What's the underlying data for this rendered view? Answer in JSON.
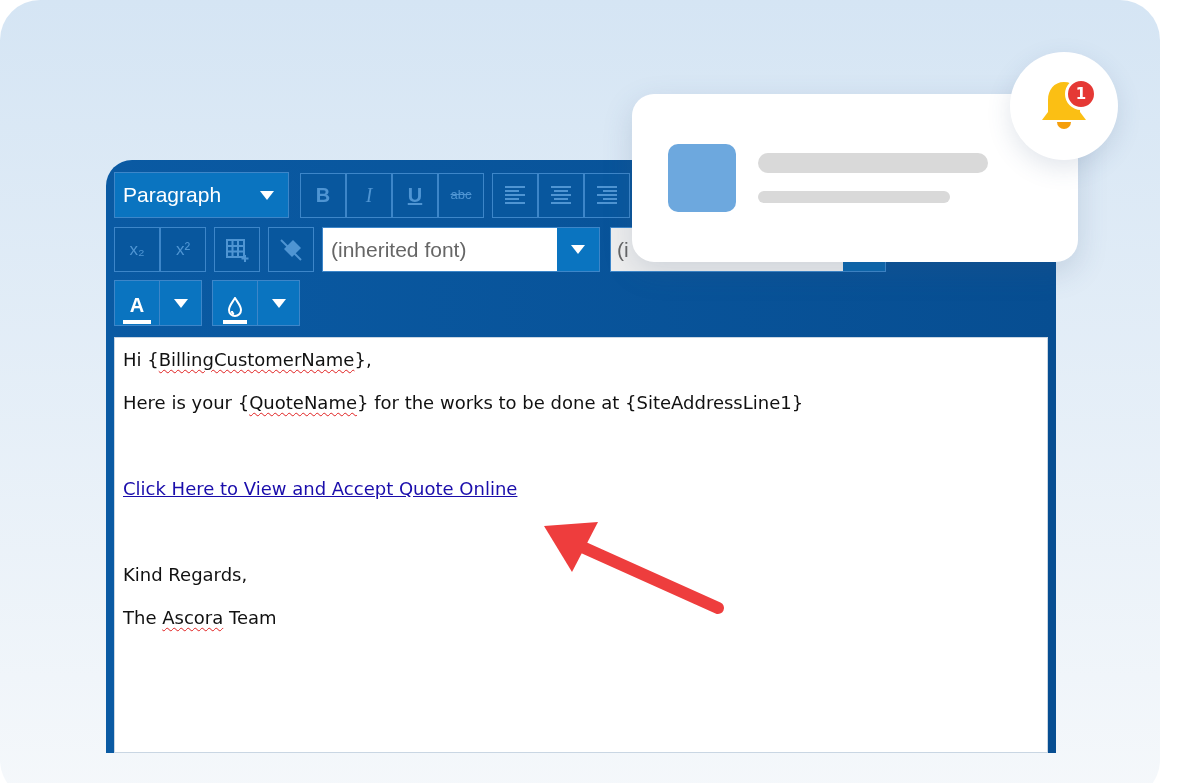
{
  "toolbar": {
    "block_format": "Paragraph",
    "row_1": [
      {
        "label": "B",
        "kind": "bold",
        "disabled": true
      },
      {
        "label": "I",
        "kind": "italic",
        "disabled": true
      },
      {
        "label": "U",
        "kind": "underline",
        "disabled": true
      },
      {
        "label": "abc",
        "kind": "strike",
        "disabled": true
      },
      {
        "kind": "align-left",
        "disabled": true
      },
      {
        "kind": "align-center",
        "disabled": true
      },
      {
        "kind": "align-right",
        "disabled": true
      }
    ],
    "row_2": [
      {
        "label": "x₂",
        "kind": "text",
        "disabled": true
      },
      {
        "label": "x²",
        "kind": "text",
        "disabled": true
      },
      {
        "kind": "table",
        "disabled": true
      },
      {
        "kind": "clear",
        "disabled": true
      }
    ],
    "font_select": "(inherited font)",
    "size_select": "(i",
    "row_3": [
      {
        "kind": "font-color",
        "label": "A"
      },
      {
        "kind": "highlight"
      }
    ]
  },
  "body": [
    {
      "kind": "line",
      "segments": [
        {
          "text": "Hi {",
          "misspelled": false
        },
        {
          "text": "BillingCustomerName",
          "misspelled": true
        },
        {
          "text": "},",
          "misspelled": false
        }
      ]
    },
    {
      "kind": "line",
      "segments": [
        {
          "text": "Here is your {",
          "misspelled": false
        },
        {
          "text": "QuoteName",
          "misspelled": true
        },
        {
          "text": "} for the works to be done at {SiteAddressLine1}",
          "misspelled": false
        }
      ]
    },
    {
      "kind": "blank"
    },
    {
      "kind": "link",
      "text": "Click Here to View and Accept Quote Online"
    },
    {
      "kind": "blank"
    },
    {
      "kind": "line",
      "segments": [
        {
          "text": "Kind Regards,",
          "misspelled": false
        }
      ]
    },
    {
      "kind": "line",
      "segments": [
        {
          "text": "The ",
          "misspelled": false
        },
        {
          "text": "Ascora",
          "misspelled": true
        },
        {
          "text": " Team",
          "misspelled": false
        }
      ]
    }
  ],
  "notification": {
    "badge": "1"
  }
}
